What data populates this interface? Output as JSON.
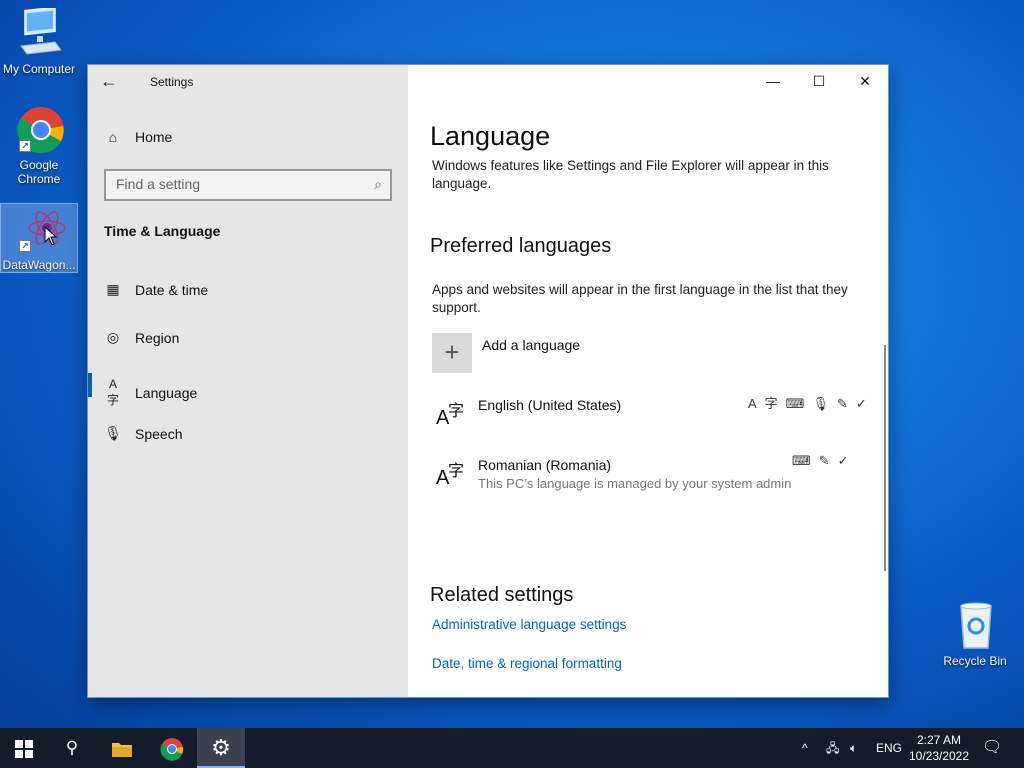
{
  "desktop": {
    "icons": [
      {
        "label": "My Computer"
      },
      {
        "label": "Google Chrome"
      },
      {
        "label": "DataWagon..."
      },
      {
        "label": "Recycle Bin"
      }
    ]
  },
  "window": {
    "title": "Settings",
    "controls": {
      "minimize": "—",
      "maximize": "☐",
      "close": "✕"
    }
  },
  "nav": {
    "home": "Home",
    "search_placeholder": "Find a setting",
    "section": "Time & Language",
    "items": [
      {
        "label": "Date & time",
        "icon": "calendar-clock-icon"
      },
      {
        "label": "Region",
        "icon": "globe-icon"
      },
      {
        "label": "Language",
        "icon": "language-icon"
      },
      {
        "label": "Speech",
        "icon": "microphone-icon"
      }
    ]
  },
  "content": {
    "title": "Language",
    "intro": "Windows features like Settings and File Explorer will appear in this language.",
    "preferred_heading": "Preferred languages",
    "preferred_desc": "Apps and websites will appear in the first language in the list that they support.",
    "add_language": "Add a language",
    "languages": [
      {
        "name": "English (United States)",
        "sub": ""
      },
      {
        "name": "Romanian (Romania)",
        "sub": "This PC’s language is managed by your system admin"
      }
    ],
    "related_heading": "Related settings",
    "links": [
      "Administrative language settings",
      "Date, time & regional formatting"
    ]
  },
  "taskbar": {
    "lang": "ENG",
    "time": "2:27 AM",
    "date": "10/23/2022"
  }
}
